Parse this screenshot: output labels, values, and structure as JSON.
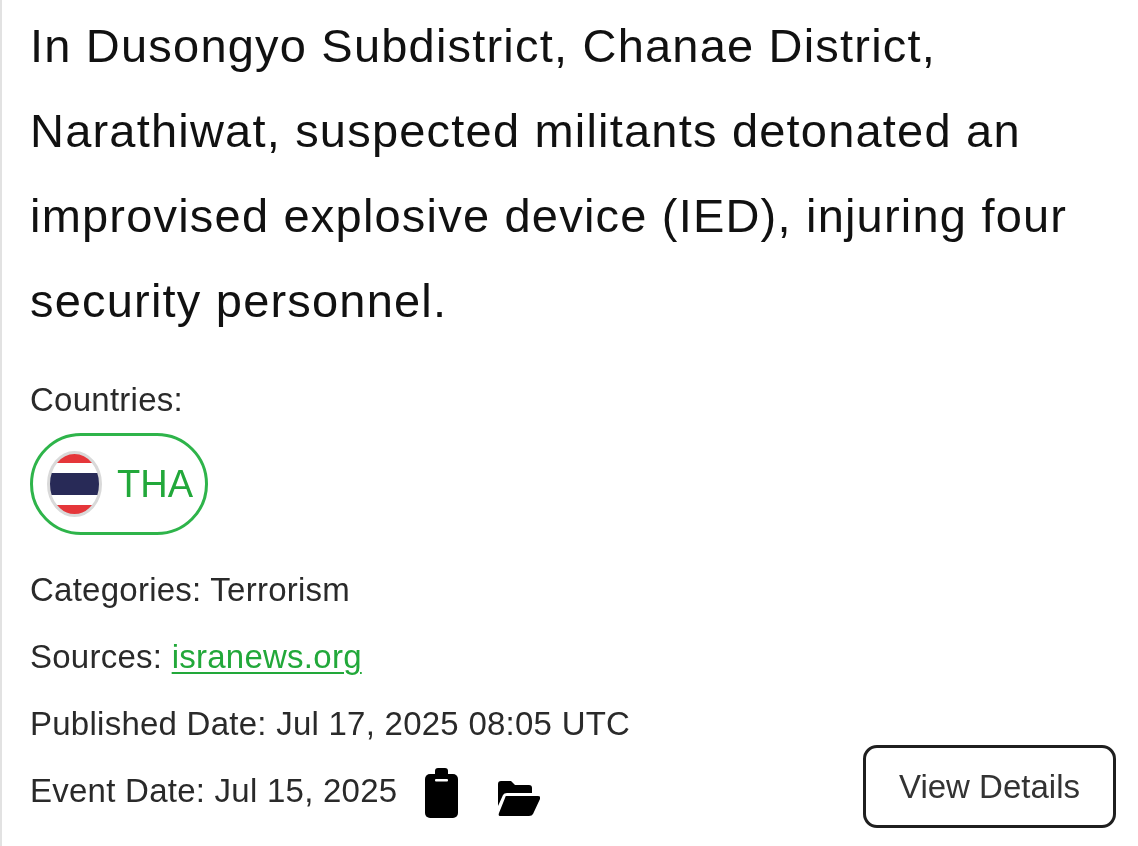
{
  "headline": "In Dusongyo Subdistrict, Chanae District, Narathiwat, suspected militants detonated an improvised explosive device (IED), injuring four security personnel.",
  "countries": {
    "label": "Countries:",
    "items": [
      {
        "code": "THA"
      }
    ]
  },
  "details": [
    {
      "kind": "text",
      "label": "Categories:",
      "value": "Terrorism"
    },
    {
      "kind": "link",
      "label": "Sources:",
      "value": "isranews.org"
    },
    {
      "kind": "text",
      "label": "Published Date:",
      "value": "Jul 17, 2025 08:05 UTC"
    }
  ],
  "event_date": {
    "label": "Event Date:",
    "value": "Jul 15, 2025"
  },
  "view_button": {
    "label": "View Details"
  }
}
